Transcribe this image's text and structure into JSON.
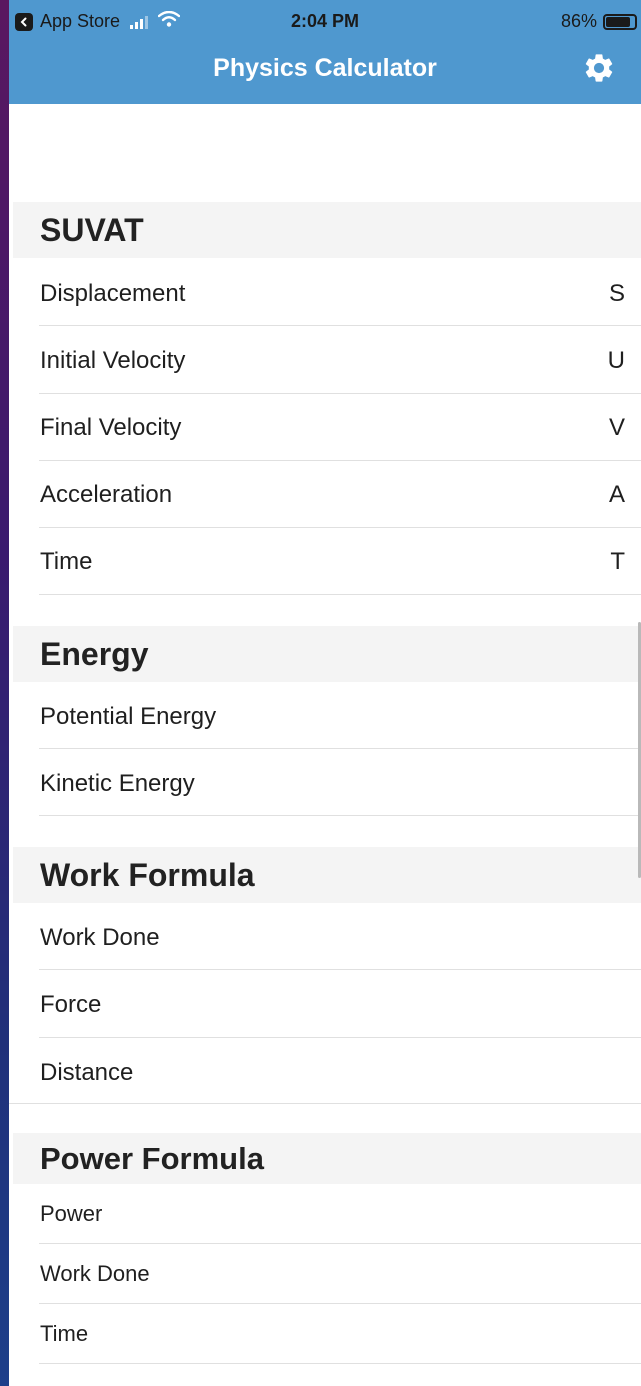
{
  "status_bar": {
    "back_app": "App Store",
    "time": "2:04 PM",
    "battery_percent": "86%",
    "battery_level": 0.86,
    "icons": [
      "back-arrow-icon",
      "signal-icon",
      "wifi-icon",
      "battery-icon"
    ]
  },
  "nav": {
    "title": "Physics Calculator",
    "settings_icon": "gear-icon"
  },
  "sections": [
    {
      "title": "SUVAT",
      "rows": [
        {
          "label": "Displacement",
          "symbol": "S"
        },
        {
          "label": "Initial Velocity",
          "symbol": "U"
        },
        {
          "label": "Final Velocity",
          "symbol": "V"
        },
        {
          "label": "Acceleration",
          "symbol": "A"
        },
        {
          "label": "Time",
          "symbol": "T"
        }
      ]
    },
    {
      "title": "Energy",
      "rows": [
        {
          "label": "Potential Energy",
          "symbol": ""
        },
        {
          "label": "Kinetic Energy",
          "symbol": ""
        }
      ]
    },
    {
      "title": "Work Formula",
      "rows": [
        {
          "label": "Work Done",
          "symbol": ""
        },
        {
          "label": "Force",
          "symbol": ""
        },
        {
          "label": "Distance",
          "symbol": ""
        }
      ]
    },
    {
      "title": "Power Formula",
      "rows": [
        {
          "label": "Power",
          "symbol": ""
        },
        {
          "label": "Work Done",
          "symbol": ""
        },
        {
          "label": "Time",
          "symbol": ""
        }
      ]
    }
  ],
  "colors": {
    "header_blue": "#4f98cf",
    "section_bg": "#f4f4f4",
    "separator": "#e0e0e0"
  }
}
